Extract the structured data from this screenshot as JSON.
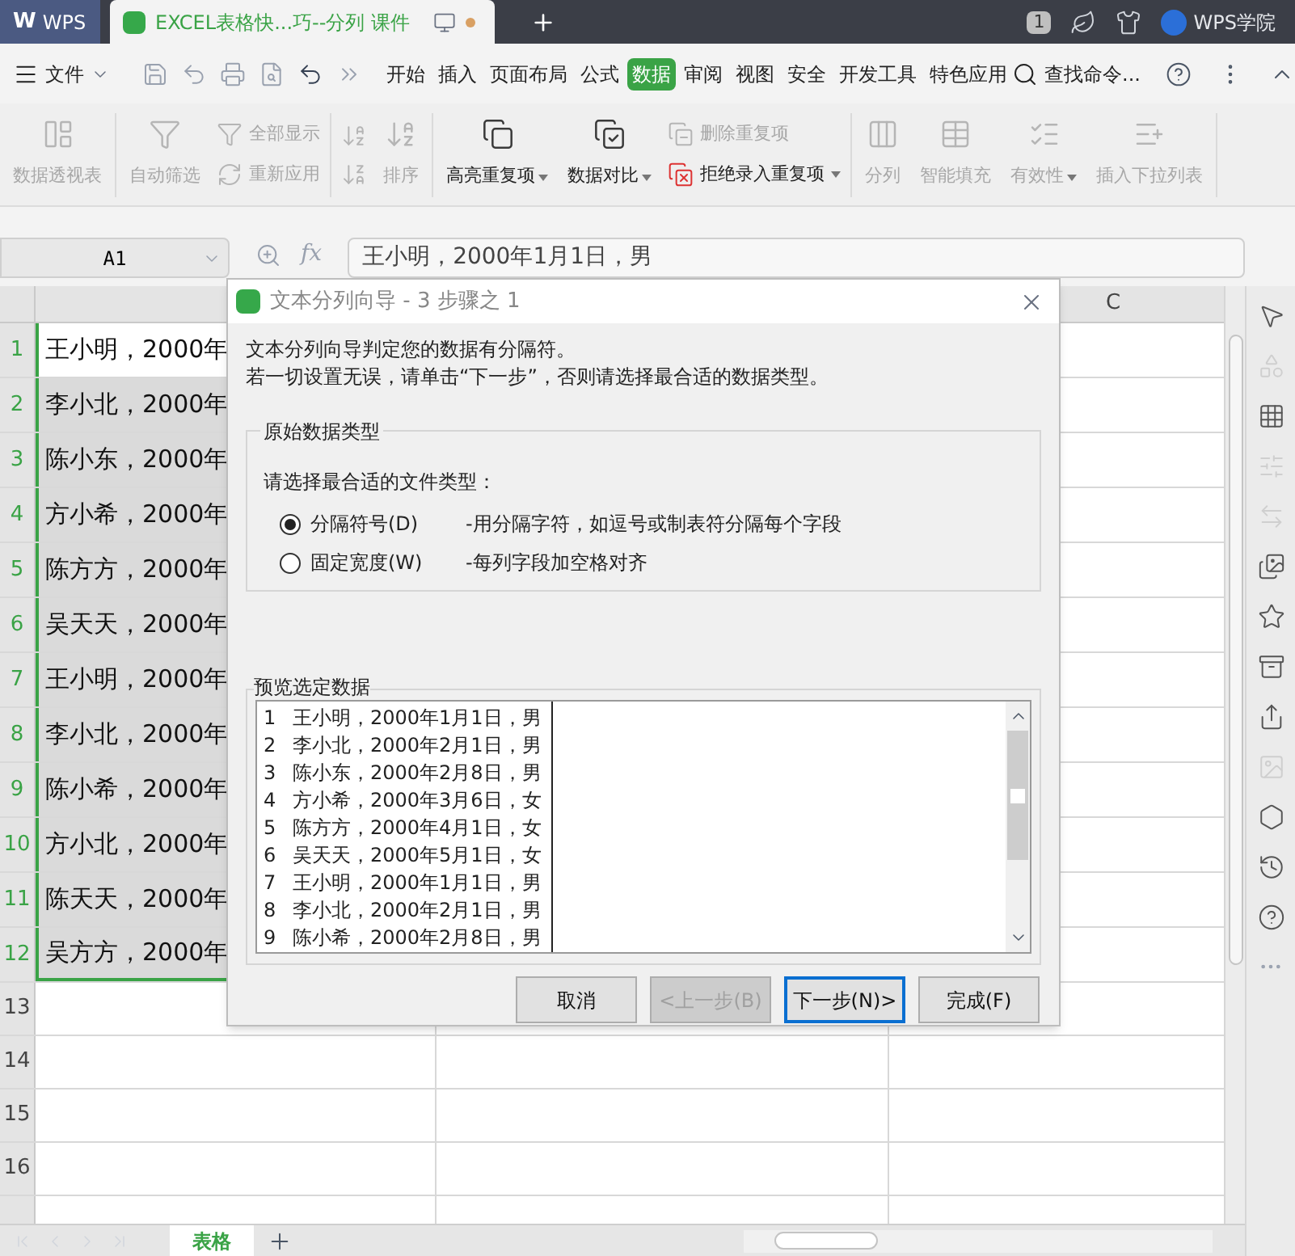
{
  "title_bar": {
    "app_logo": "W",
    "app_tab": "WPS",
    "document_tab": "EXCEL表格快...巧--分列 课件",
    "window_count": "1",
    "academy": "WPS学院"
  },
  "menu_bar": {
    "file": "文件",
    "tabs": [
      {
        "label": "开始",
        "selected": false
      },
      {
        "label": "插入",
        "selected": false
      },
      {
        "label": "页面布局",
        "selected": false
      },
      {
        "label": "公式",
        "selected": false
      },
      {
        "label": "数据",
        "selected": true
      },
      {
        "label": "审阅",
        "selected": false
      },
      {
        "label": "视图",
        "selected": false
      },
      {
        "label": "安全",
        "selected": false
      },
      {
        "label": "开发工具",
        "selected": false
      },
      {
        "label": "特色应用",
        "selected": false
      }
    ],
    "search": "查找命令..."
  },
  "ribbon": {
    "groups": [
      {
        "columns": [
          {
            "kind": "large",
            "label": "数据透视表",
            "disabled": true,
            "dropdown": false
          }
        ]
      },
      {
        "columns": [
          {
            "kind": "large",
            "label": "自动筛选",
            "disabled": true,
            "dropdown": false
          },
          {
            "kind": "stack",
            "items": [
              {
                "label": "全部显示",
                "disabled": true
              },
              {
                "label": "重新应用",
                "disabled": true
              }
            ]
          }
        ]
      },
      {
        "columns": [
          {
            "kind": "stack",
            "items": [
              {
                "disabled": true
              },
              {
                "disabled": true
              }
            ]
          },
          {
            "kind": "large",
            "label": "排序",
            "disabled": true,
            "dropdown": false
          }
        ]
      },
      {
        "columns": [
          {
            "kind": "large",
            "label": "高亮重复项",
            "disabled": false,
            "dropdown": true
          },
          {
            "kind": "large",
            "label": "数据对比",
            "disabled": false,
            "dropdown": true
          },
          {
            "kind": "stack",
            "items": [
              {
                "label": "删除重复项",
                "disabled": true
              },
              {
                "label": "拒绝录入重复项",
                "disabled": false,
                "dropdown": true
              }
            ]
          }
        ]
      },
      {
        "columns": [
          {
            "kind": "large",
            "label": "分列",
            "disabled": true,
            "dropdown": false
          },
          {
            "kind": "large",
            "label": "智能填充",
            "disabled": true,
            "dropdown": false
          },
          {
            "kind": "large",
            "label": "有效性",
            "disabled": true,
            "dropdown": true
          },
          {
            "kind": "large",
            "label": "插入下拉列表",
            "disabled": true,
            "dropdown": false
          }
        ]
      }
    ]
  },
  "formula_bar": {
    "name_box": "A1",
    "function_label": "fx",
    "formula": "王小明，2000年1月1日，男"
  },
  "sheet": {
    "visible_column_header": "C",
    "rows": [
      {
        "number": "1",
        "cell_a": "王小明，2000年",
        "active": true
      },
      {
        "number": "2",
        "cell_a": "李小北，2000年",
        "active": false
      },
      {
        "number": "3",
        "cell_a": "陈小东，2000年",
        "active": false
      },
      {
        "number": "4",
        "cell_a": "方小希，2000年",
        "active": false
      },
      {
        "number": "5",
        "cell_a": "陈方方，2000年",
        "active": false
      },
      {
        "number": "6",
        "cell_a": "吴天天，2000年",
        "active": false
      },
      {
        "number": "7",
        "cell_a": "王小明，2000年",
        "active": false
      },
      {
        "number": "8",
        "cell_a": "李小北，2000年",
        "active": false
      },
      {
        "number": "9",
        "cell_a": "陈小希，2000年",
        "active": false
      },
      {
        "number": "10",
        "cell_a": "方小北，2000年",
        "active": false
      },
      {
        "number": "11",
        "cell_a": "陈天天，2000年",
        "active": false
      },
      {
        "number": "12",
        "cell_a": "吴方方，2000年",
        "active": false
      }
    ],
    "empty_rows": [
      "13",
      "14",
      "15",
      "16"
    ],
    "sheet_tabs": [
      {
        "label": "表格",
        "selected": true
      }
    ]
  },
  "side_panel": {
    "tools": [
      {
        "disabled": false
      },
      {
        "disabled": true
      },
      {
        "disabled": false
      },
      {
        "disabled": true
      },
      {
        "disabled": true
      },
      {
        "disabled": false
      },
      {
        "disabled": false
      },
      {
        "disabled": false
      },
      {
        "disabled": false
      },
      {
        "disabled": true
      },
      {
        "disabled": false
      },
      {
        "disabled": false
      },
      {
        "disabled": false
      }
    ]
  },
  "dialog": {
    "title": "文本分列向导 - 3 步骤之 1",
    "intro": [
      "文本分列向导判定您的数据有分隔符。",
      "若一切设置无误，请单击“下一步”，否则请选择最合适的数据类型。"
    ],
    "group_title": "原始数据类型",
    "prompt": "请选择最合适的文件类型：",
    "options": [
      {
        "label": "分隔符号(D)",
        "description": "-用分隔字符，如逗号或制表符分隔每个字段",
        "selected": true
      },
      {
        "label": "固定宽度(W)",
        "description": "-每列字段加空格对齐",
        "selected": false
      }
    ],
    "preview_title": "预览选定数据",
    "preview_rows": [
      {
        "number": "1",
        "text": "王小明，2000年1月1日，男"
      },
      {
        "number": "2",
        "text": "李小北，2000年2月1日，男"
      },
      {
        "number": "3",
        "text": "陈小东，2000年2月8日，男"
      },
      {
        "number": "4",
        "text": "方小希，2000年3月6日，女"
      },
      {
        "number": "5",
        "text": "陈方方，2000年4月1日，女"
      },
      {
        "number": "6",
        "text": "吴天天，2000年5月1日，女"
      },
      {
        "number": "7",
        "text": "王小明，2000年1月1日，男"
      },
      {
        "number": "8",
        "text": "李小北，2000年2月1日，男"
      },
      {
        "number": "9",
        "text": "陈小希，2000年2月8日，男"
      }
    ],
    "buttons": [
      {
        "label": "取消",
        "disabled": false,
        "default": false
      },
      {
        "label": "<上一步(B)",
        "disabled": true,
        "default": false
      },
      {
        "label": "下一步(N)>",
        "disabled": false,
        "default": true
      },
      {
        "label": "完成(F)",
        "disabled": false,
        "default": false
      }
    ]
  }
}
